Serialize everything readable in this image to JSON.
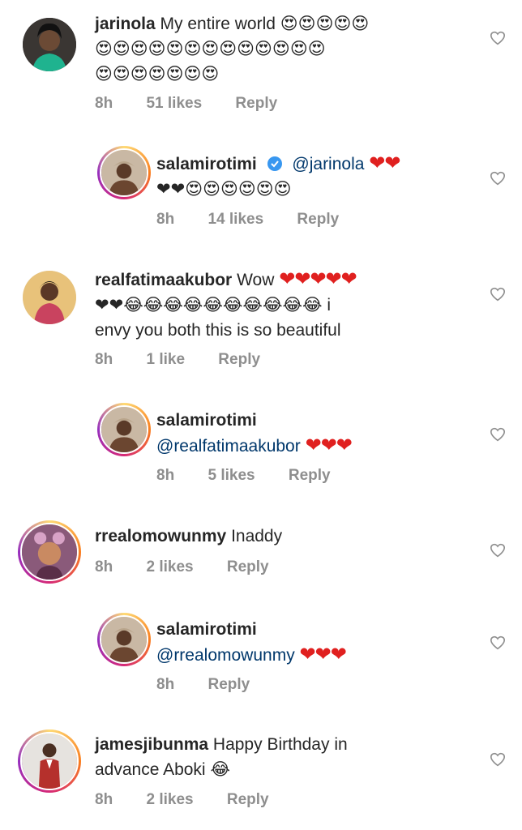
{
  "comments": [
    {
      "username": "jarinola",
      "text": "My entire world",
      "emojis_line1": "😍😍😍😍😍",
      "emojis_line2": "😍😍😍😍😍😍😍😍😍😍😍😍😍",
      "emojis_line3": "😍😍😍😍😍😍😍",
      "time": "8h",
      "likes": "51 likes",
      "reply": "Reply"
    },
    {
      "username": "salamirotimi",
      "mention": "@jarinola",
      "hearts": "❤❤",
      "emojis_line2": "❤❤😍😍😍😍😍😍",
      "time": "8h",
      "likes": "14 likes",
      "reply": "Reply"
    },
    {
      "username": "realfatimaakubor",
      "text": "Wow",
      "hearts": "❤❤❤❤❤",
      "emojis_line2": "❤❤😂😂😂😂😂😂😂😂😂😂",
      "text_suffix": "i",
      "text_line3": "envy you both this is so beautiful",
      "time": "8h",
      "likes": "1 like",
      "reply": "Reply"
    },
    {
      "username": "salamirotimi",
      "mention": "@realfatimaakubor",
      "hearts": "❤❤❤",
      "time": "8h",
      "likes": "5 likes",
      "reply": "Reply"
    },
    {
      "username": "rrealomowunmy",
      "text": "Inaddy",
      "time": "8h",
      "likes": "2 likes",
      "reply": "Reply"
    },
    {
      "username": "salamirotimi",
      "mention": "@rrealomowunmy",
      "hearts": "❤❤❤",
      "time": "8h",
      "reply": "Reply"
    },
    {
      "username": "jamesjibunma",
      "text": "Happy Birthday in",
      "text_line2": "advance Aboki",
      "emoji": "😂",
      "time": "8h",
      "likes": "2 likes",
      "reply": "Reply"
    }
  ],
  "icons": {
    "like": "heart-outline-icon",
    "verified": "verified-badge-icon"
  },
  "colors": {
    "username": "#262626",
    "mention": "#00376b",
    "meta": "#8e8e8e",
    "heart": "#e0201f",
    "verified": "#3897f0"
  }
}
